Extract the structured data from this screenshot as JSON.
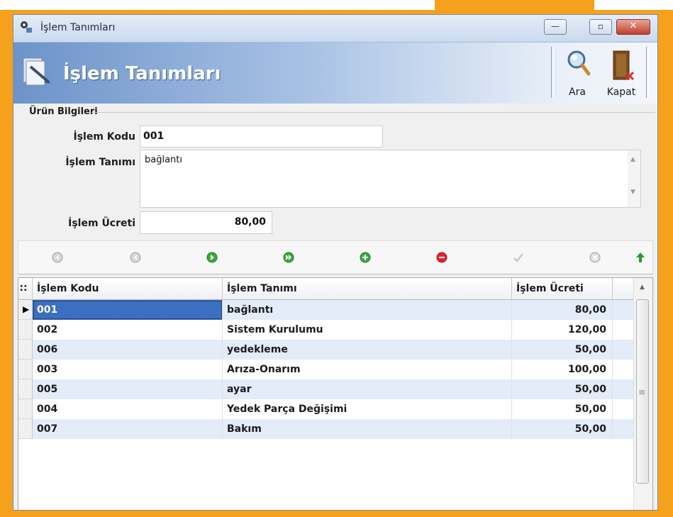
{
  "window": {
    "title": "İşlem Tanımları",
    "minimize_glyph": "—",
    "maximize_glyph": "▫",
    "close_glyph": "✕"
  },
  "banner": {
    "title": "İşlem Tanımları",
    "toolbar": [
      {
        "label": "Ara",
        "icon": "magnifier-icon"
      },
      {
        "label": "Kapat",
        "icon": "door-exit-icon"
      }
    ]
  },
  "form": {
    "group_label": "Ürün Bilgileri",
    "islem_kodu_label": "İşlem Kodu",
    "islem_kodu_value": "001",
    "islem_tanimi_label": "İşlem Tanımı",
    "islem_tanimi_value": "bağlantı",
    "islem_ucreti_label": "İşlem Ücreti",
    "islem_ucreti_value": "80,00"
  },
  "navigator": [
    {
      "name": "first-record",
      "icon": "first-icon"
    },
    {
      "name": "previous-record",
      "icon": "previous-icon"
    },
    {
      "name": "next-record",
      "icon": "next-icon"
    },
    {
      "name": "last-record",
      "icon": "last-icon"
    },
    {
      "name": "insert-record",
      "icon": "plus-icon"
    },
    {
      "name": "delete-record",
      "icon": "minus-icon"
    },
    {
      "name": "post-edit",
      "icon": "check-icon"
    },
    {
      "name": "cancel-edit",
      "icon": "cancel-icon"
    },
    {
      "name": "refresh",
      "icon": "up-arrow-icon"
    }
  ],
  "grid": {
    "columns": [
      "İşlem Kodu",
      "İşlem Tanımı",
      "İşlem Ücreti"
    ],
    "rows": [
      {
        "kod": "001",
        "tanim": "bağlantı",
        "ucret": "80,00"
      },
      {
        "kod": "002",
        "tanim": "Sistem Kurulumu",
        "ucret": "120,00"
      },
      {
        "kod": "006",
        "tanim": "yedekleme",
        "ucret": "50,00"
      },
      {
        "kod": "003",
        "tanim": "Arıza-Onarım",
        "ucret": "100,00"
      },
      {
        "kod": "005",
        "tanim": "ayar",
        "ucret": "50,00"
      },
      {
        "kod": "004",
        "tanim": "Yedek Parça Değişimi",
        "ucret": "50,00"
      },
      {
        "kod": "007",
        "tanim": "Bakım",
        "ucret": "50,00"
      }
    ],
    "selected_row": 0
  },
  "colors": {
    "frame": "#f5a11c",
    "selection": "#3c6fc1",
    "row_alt": "#e3ecf8"
  }
}
